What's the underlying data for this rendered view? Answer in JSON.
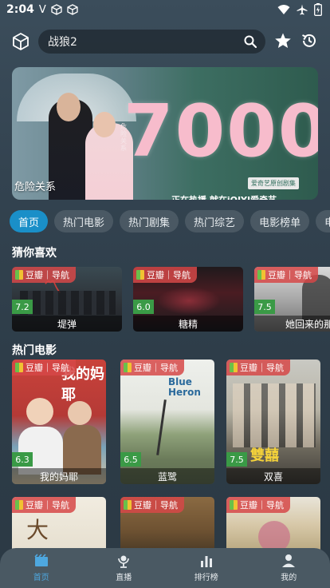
{
  "status": {
    "time": "2:04",
    "left_icons": [
      "v-icon",
      "box-icon",
      "box-icon"
    ],
    "right_icons": [
      "wifi-icon",
      "airplane-icon",
      "battery-icon"
    ]
  },
  "top_bar": {
    "search_value": "战狼2"
  },
  "banner": {
    "title": "危险关系",
    "big_text": "7000",
    "tag": "爱奇艺原创剧集",
    "subtitle": "正在热播 就在iQIYI爱奇艺",
    "vertical_text": "危险关系"
  },
  "tabs": [
    "首页",
    "热门电影",
    "热门剧集",
    "热门综艺",
    "电影榜单",
    "电视"
  ],
  "badge_text": "豆瓣｜导航",
  "sections": {
    "guess": "猜你喜欢",
    "hot_movies": "热门电影"
  },
  "guess_items": [
    {
      "title": "堤弹",
      "rating": "7.2"
    },
    {
      "title": "糖精",
      "rating": "6.0"
    },
    {
      "title": "她回来的那",
      "rating": "7.5"
    }
  ],
  "hot_items": [
    {
      "title": "我的妈耶",
      "rating": "6.3"
    },
    {
      "title": "蓝鹭",
      "rating": "6.5"
    },
    {
      "title": "双喜",
      "rating": "7.5"
    }
  ],
  "poster_texts": {
    "blue_heron": "Blue Heron",
    "mom": "我的妈耶",
    "double": "雙囍"
  },
  "bottom_nav": [
    {
      "label": "首页",
      "icon": "film-icon"
    },
    {
      "label": "直播",
      "icon": "live-icon"
    },
    {
      "label": "排行榜",
      "icon": "chart-icon"
    },
    {
      "label": "我的",
      "icon": "user-icon"
    }
  ],
  "colors": {
    "accent": "#1a8fc8",
    "badge": "#d64848",
    "rating": "#3a9a46",
    "nav_active": "#4ea8e0"
  }
}
